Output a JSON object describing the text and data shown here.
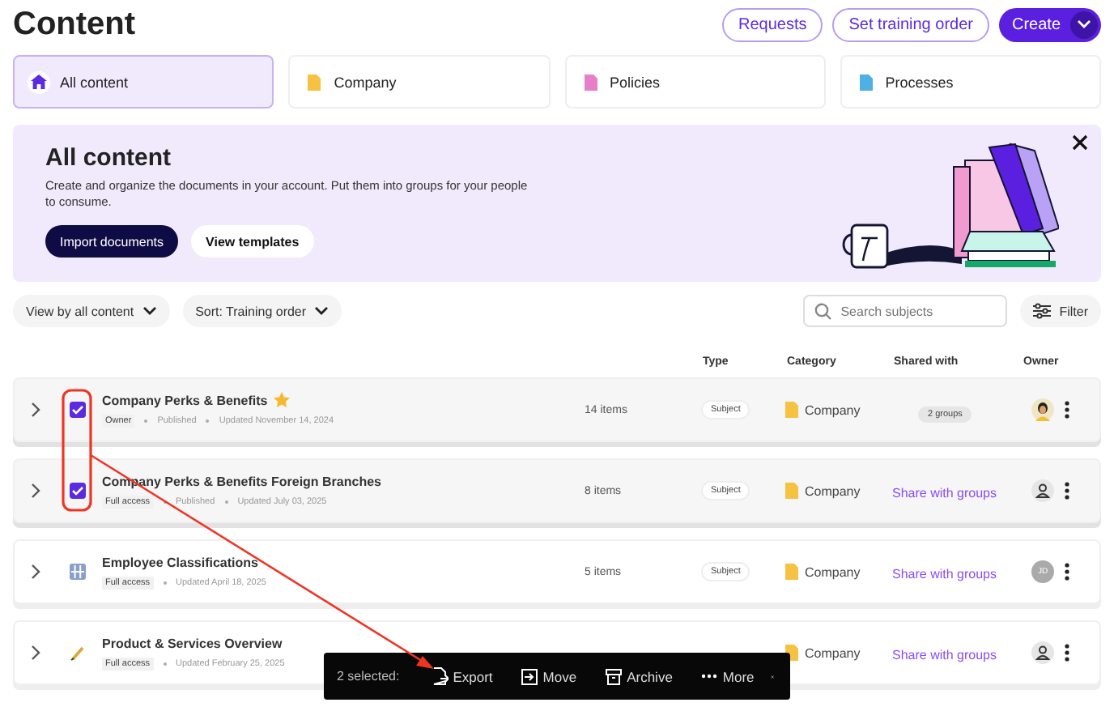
{
  "header": {
    "title": "Content",
    "buttons": [
      {
        "label": "Requests",
        "kind": "outline"
      },
      {
        "label": "Set training order",
        "kind": "outline"
      },
      {
        "label": "Create",
        "kind": "primary"
      }
    ]
  },
  "categories": [
    {
      "label": "All content",
      "selected": true,
      "kind": "home",
      "color": "#5b2be0"
    },
    {
      "label": "Company",
      "selected": false,
      "kind": "doc",
      "color": "#f5c242"
    },
    {
      "label": "Policies",
      "selected": false,
      "kind": "doc",
      "color": "#e77fc8"
    },
    {
      "label": "Processes",
      "selected": false,
      "kind": "doc",
      "color": "#4fb0e6"
    }
  ],
  "banner": {
    "title": "All content",
    "text": "Create and organize the documents in your account. Put them into groups for your people to consume.",
    "buttons": [
      {
        "label": "Import documents",
        "kind": "primary"
      },
      {
        "label": "View templates",
        "kind": "secondary"
      }
    ]
  },
  "filters": [
    {
      "label": "View by all content"
    },
    {
      "label": "Sort: Training order"
    }
  ],
  "search": {
    "placeholder": "Search subjects"
  },
  "filter_button": "Filter",
  "table": {
    "columns": [
      "Type",
      "Category",
      "Shared with",
      "Owner"
    ],
    "rows": [
      {
        "title": "Company Perks & Benefits",
        "starred": true,
        "checked": true,
        "selected": true,
        "role": "Owner",
        "status": "Published",
        "updated": "Updated November 14, 2024",
        "items": "14 items",
        "type": "Subject",
        "category": "Company",
        "shared": {
          "kind": "badge",
          "label": "2 groups"
        }
      },
      {
        "title": "Company Perks & Benefits Foreign Branches",
        "starred": false,
        "checked": true,
        "selected": true,
        "role": "Full access",
        "status": "Published",
        "updated": "Updated July 03, 2025",
        "items": "8 items",
        "type": "Subject",
        "category": "Company",
        "shared": {
          "kind": "link",
          "label": "Share with groups"
        },
        "owner": {
          "kind": "none"
        }
      },
      {
        "title": "Employee Classifications",
        "starred": false,
        "checked": false,
        "selected": false,
        "role": "Full access",
        "updated": "Updated April 18, 2025",
        "items": "5 items",
        "type": "Subject",
        "category": "Company",
        "shared": {
          "kind": "link",
          "label": "Share with groups"
        },
        "owner": {
          "kind": "initials",
          "initials": "JD"
        }
      },
      {
        "title": "Product & Services Overview",
        "starred": false,
        "checked": false,
        "selected": false,
        "role": "Full access",
        "updated": "Updated February 25, 2025",
        "category": "Company",
        "shared": {
          "kind": "link",
          "label": "Share with groups"
        },
        "owner": {
          "kind": "none"
        }
      }
    ]
  },
  "selection_bar": {
    "count": "2 selected:",
    "actions": [
      "Export",
      "Move",
      "Archive",
      "More"
    ]
  }
}
